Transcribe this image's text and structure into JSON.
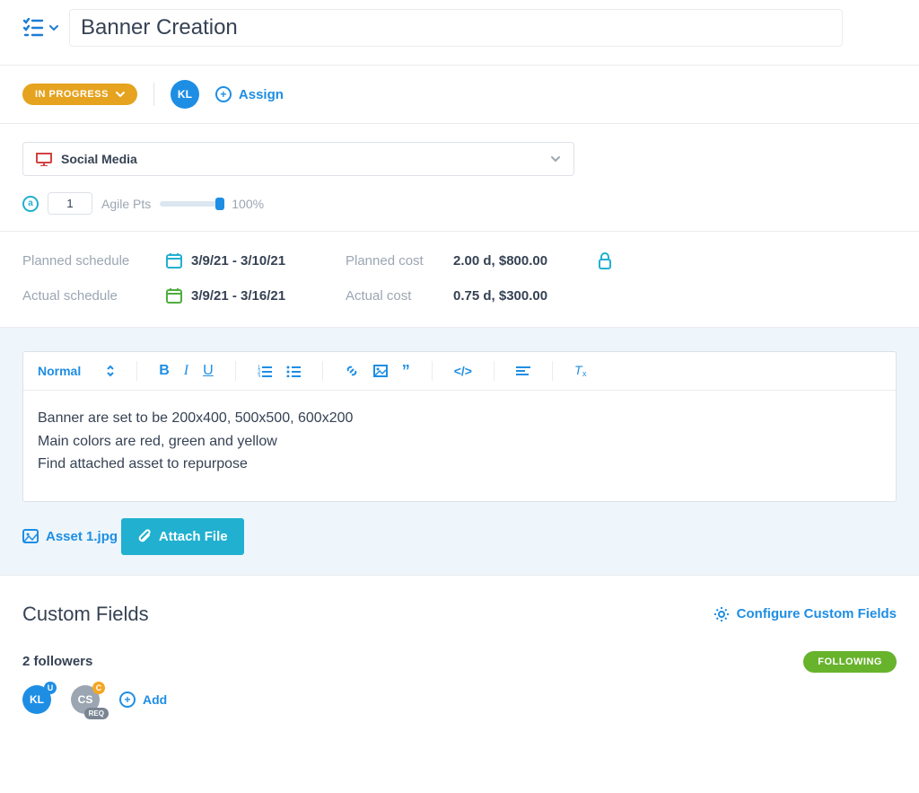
{
  "title": "Banner Creation",
  "status": {
    "label": "IN PROGRESS"
  },
  "assignee": {
    "initials": "KL"
  },
  "assign_label": "Assign",
  "category": "Social Media",
  "agile": {
    "points": "1",
    "label": "Agile Pts",
    "progress": "100%"
  },
  "schedule": {
    "planned_label": "Planned schedule",
    "planned_value": "3/9/21 - 3/10/21",
    "actual_label": "Actual schedule",
    "actual_value": "3/9/21 - 3/16/21",
    "planned_cost_label": "Planned cost",
    "planned_cost_value": "2.00 d, $800.00",
    "actual_cost_label": "Actual cost",
    "actual_cost_value": "0.75 d, $300.00"
  },
  "editor": {
    "format_label": "Normal",
    "line1": "Banner are set to be 200x400, 500x500, 600x200",
    "line2": "Main colors are red, green and yellow",
    "line3": "Find attached asset to repurpose"
  },
  "attachment_name": "Asset 1.jpg",
  "attach_btn": "Attach File",
  "custom_fields_title": "Custom Fields",
  "configure_label": "Configure Custom Fields",
  "followers": {
    "count_label": "2 followers",
    "following_label": "FOLLOWING",
    "items": [
      {
        "initials": "KL",
        "badge": "U"
      },
      {
        "initials": "CS",
        "badge": "C",
        "req": "REQ"
      }
    ],
    "add_label": "Add"
  }
}
